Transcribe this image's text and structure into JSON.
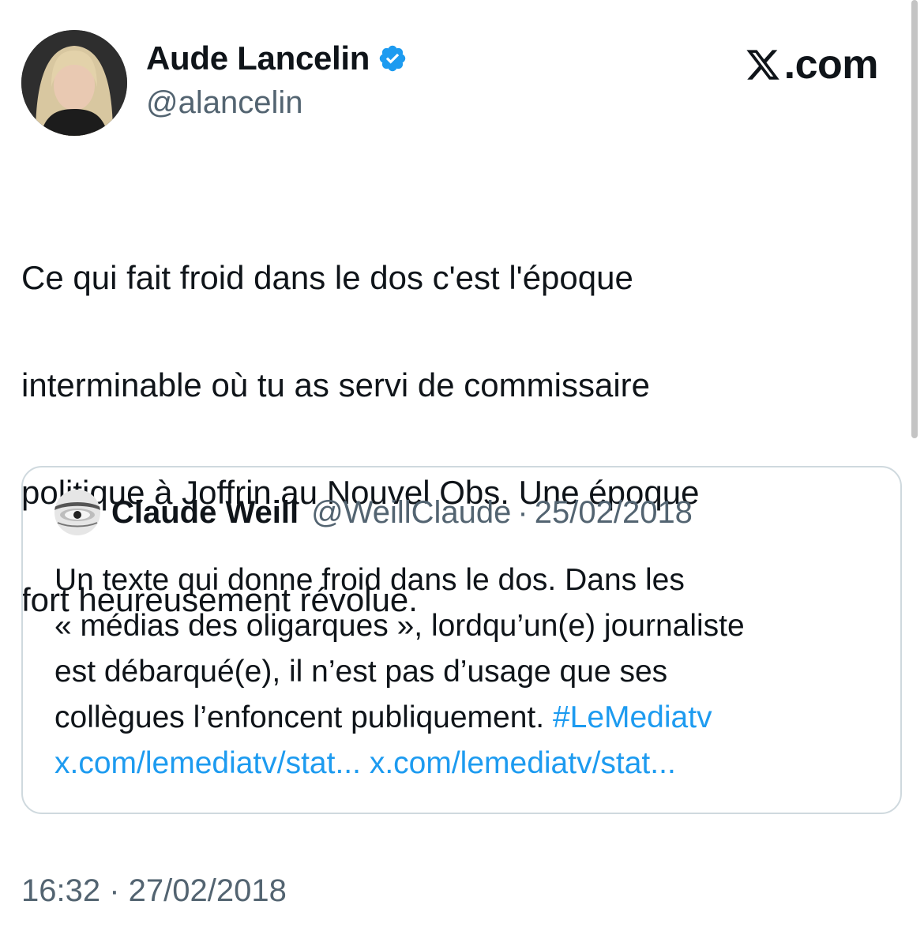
{
  "author": {
    "display_name": "Aude Lancelin",
    "handle": "@alancelin",
    "verified_icon": "verified-badge-icon",
    "avatar": "avatar"
  },
  "brand": {
    "label": ".com",
    "logo_icon": "x-logo-icon"
  },
  "tweet": {
    "text_lines": [
      "Ce qui fait froid dans le dos c'est l'époque",
      "interminable où tu as servi de commissaire",
      "politique à Joffrin au Nouvel Obs. Une époque",
      "fort heureusement révolue."
    ],
    "timestamp": "16:32 · 27/02/2018"
  },
  "quote": {
    "display_name": "Claude Weill",
    "handle": "@WeillClaude",
    "separator": "·",
    "date": "25/02/2018",
    "lines": [
      "Un texte qui donne froid dans le dos. Dans les",
      "« médias des oligarques », lordqu’un(e) journaliste",
      "est débarqué(e), il n’est pas d’usage que ses",
      "collègues l’enfoncent publiquement. "
    ],
    "hashtag": "#LeMediatv",
    "link_1": "x.com/lemediatv/stat...",
    "link_2": "x.com/lemediatv/stat..."
  },
  "colors": {
    "text": "#0f1419",
    "secondary": "#536471",
    "link": "#1d9bf0",
    "border": "#cfd9de"
  }
}
